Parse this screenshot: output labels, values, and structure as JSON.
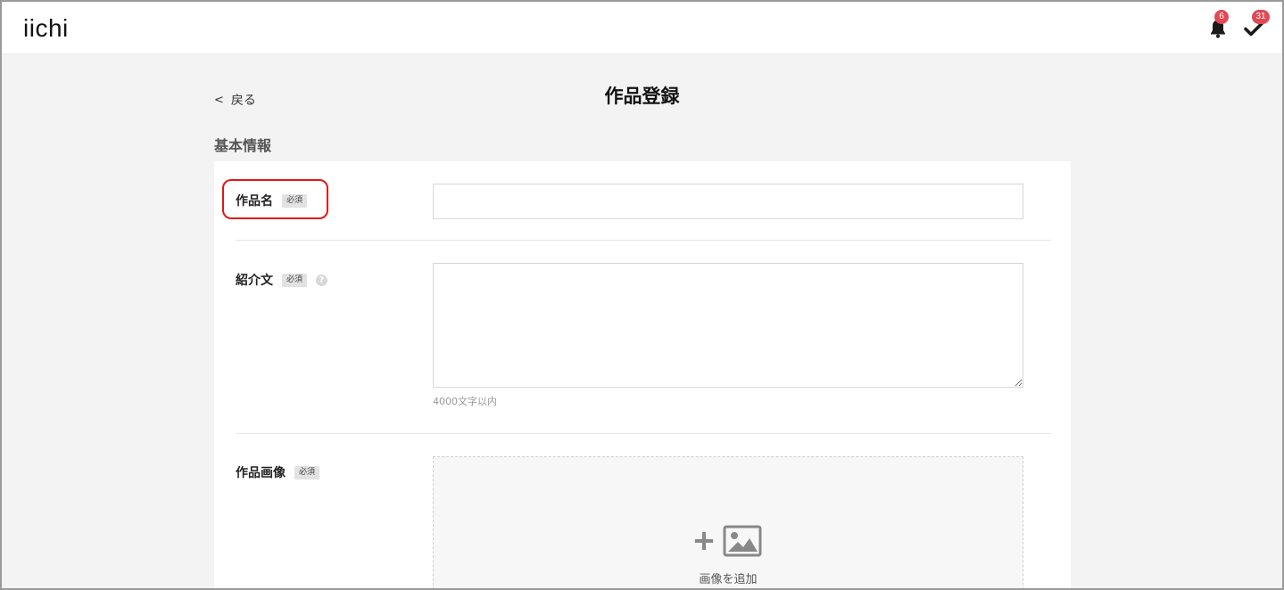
{
  "header": {
    "logo": "iichi",
    "notifications_count": "6",
    "tasks_count": "31"
  },
  "nav": {
    "back_label": "戻る",
    "page_title": "作品登録"
  },
  "section": {
    "title": "基本情報"
  },
  "form": {
    "required_label": "必須",
    "title_field": {
      "label": "作品名",
      "value": "",
      "placeholder": ""
    },
    "description_field": {
      "label": "紹介文",
      "value": "",
      "hint": "4000文字以内"
    },
    "image_field": {
      "label": "作品画像",
      "add_label": "画像を追加"
    }
  },
  "colors": {
    "badge": "#e04a55",
    "highlight": "#e01818",
    "background": "#f3f3f3"
  },
  "icons": {
    "bell": "bell-icon",
    "check": "check-icon",
    "help": "question-icon",
    "plus": "plus-icon",
    "image": "image-icon"
  }
}
